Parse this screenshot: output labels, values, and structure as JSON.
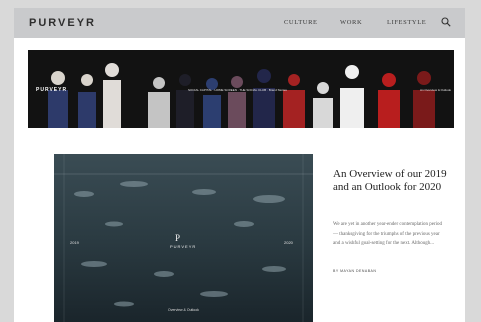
{
  "site": {
    "logo": "PURVEYR",
    "nav": [
      {
        "label": "CULTURE"
      },
      {
        "label": "WORK"
      },
      {
        "label": "LIFESTYLE"
      }
    ]
  },
  "banner": {
    "logo": "PURVEYR",
    "caption": "SOCIAL CAPITAL · HOME SCREEN · THE SOCIAL CLUB · Brand Stories",
    "caption_right": "An Overview & Outlook"
  },
  "hero": {
    "mark": "P",
    "brand": "PURVEYR",
    "year_left": "2019",
    "year_right": "2020",
    "credit": "Overview & Outlook"
  },
  "article": {
    "title": "An Overview of our 2019 and an Outlook for 2020",
    "excerpt": "We are yet in another year-ender contemplation period — thanksgiving for the triumphs of the previous year and a wishful goal-setting for the next. Although...",
    "byline": "BY MAYAN DENABAN"
  },
  "colors": {
    "topbar": "#c9cacc",
    "banner_background": "#141414",
    "hero_background": "#2a3a40"
  }
}
